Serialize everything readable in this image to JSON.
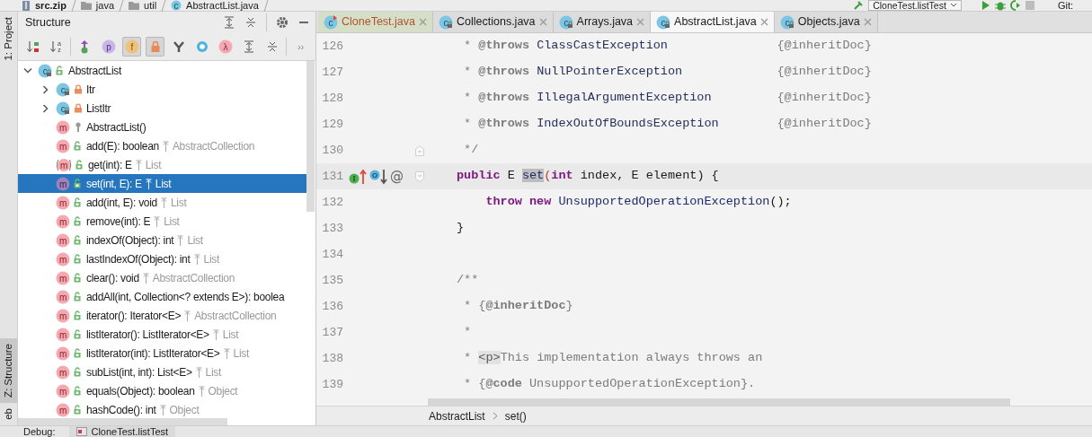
{
  "path_bar": {
    "segments": [
      {
        "label": "src.zip",
        "kind": "archive"
      },
      {
        "label": "java",
        "kind": "folder"
      },
      {
        "label": "util",
        "kind": "folder"
      },
      {
        "label": "AbstractList.java",
        "kind": "class-file",
        "badge": "c"
      }
    ],
    "run_config": "CloneTest.listTest",
    "vcs_label": "Git:"
  },
  "tool_stripe": {
    "top": [
      {
        "label": "1: Project",
        "selected": false
      }
    ],
    "bottom": [
      {
        "label": "Z: Structure",
        "selected": true
      },
      {
        "label": "eb",
        "selected": false
      }
    ]
  },
  "structure": {
    "title": "Structure",
    "toolbar": [
      {
        "kind": "sort-visibility",
        "pressed": false
      },
      {
        "kind": "sort-alpha",
        "glyph": "az",
        "pressed": false
      },
      {
        "kind": "separator"
      },
      {
        "kind": "inherited",
        "pressed": false
      },
      {
        "kind": "properties",
        "glyph": "p",
        "pressed": false
      },
      {
        "kind": "fields",
        "glyph": "f",
        "pressed": true
      },
      {
        "kind": "non-public",
        "pressed": true
      },
      {
        "kind": "anonymous",
        "pressed": false
      },
      {
        "kind": "circle",
        "pressed": false
      },
      {
        "kind": "lambda",
        "glyph": "λ",
        "pressed": false
      },
      {
        "kind": "expand",
        "pressed": false
      },
      {
        "kind": "collapse",
        "pressed": false
      },
      {
        "kind": "separator"
      },
      {
        "kind": "more",
        "glyph": "››",
        "pressed": false
      }
    ],
    "tree": [
      {
        "label": "AbstractList",
        "kind": "class",
        "badge": "c",
        "access": {
          "kind": "public"
        },
        "expanded": true,
        "selected": false,
        "children": [
          {
            "label": "Itr",
            "kind": "class",
            "badge": "c",
            "access": {
              "kind": "private"
            },
            "expanded": false,
            "selected": false
          },
          {
            "label": "ListItr",
            "kind": "class",
            "badge": "c",
            "access": {
              "kind": "private"
            },
            "expanded": false,
            "selected": false
          },
          {
            "label": "AbstractList()",
            "kind": "method",
            "badge": "m",
            "access": {
              "kind": "protected"
            },
            "selected": false
          },
          {
            "label": "add(E): boolean",
            "kind": "method",
            "badge": "m",
            "access": {
              "kind": "public"
            },
            "origin": "AbstractCollection",
            "selected": false
          },
          {
            "label": "get(int): E",
            "kind": "abstract-method",
            "badge": "m",
            "access": {
              "kind": "public"
            },
            "origin": "List",
            "selected": false
          },
          {
            "label": "set(int, E): E",
            "kind": "method",
            "badge": "m",
            "access": {
              "kind": "public"
            },
            "origin": "List",
            "selected": true
          },
          {
            "label": "add(int, E): void",
            "kind": "method",
            "badge": "m",
            "access": {
              "kind": "public"
            },
            "origin": "List",
            "selected": false
          },
          {
            "label": "remove(int): E",
            "kind": "method",
            "badge": "m",
            "access": {
              "kind": "public"
            },
            "origin": "List",
            "selected": false
          },
          {
            "label": "indexOf(Object): int",
            "kind": "method",
            "badge": "m",
            "access": {
              "kind": "public"
            },
            "origin": "List",
            "selected": false
          },
          {
            "label": "lastIndexOf(Object): int",
            "kind": "method",
            "badge": "m",
            "access": {
              "kind": "public"
            },
            "origin": "List",
            "selected": false
          },
          {
            "label": "clear(): void",
            "kind": "method",
            "badge": "m",
            "access": {
              "kind": "public"
            },
            "origin": "AbstractCollection",
            "selected": false
          },
          {
            "label": "addAll(int, Collection<? extends E>): boolea",
            "kind": "method",
            "badge": "m",
            "access": {
              "kind": "public"
            },
            "selected": false
          },
          {
            "label": "iterator(): Iterator<E>",
            "kind": "method",
            "badge": "m",
            "access": {
              "kind": "public"
            },
            "origin": "AbstractCollection",
            "selected": false
          },
          {
            "label": "listIterator(): ListIterator<E>",
            "kind": "method",
            "badge": "m",
            "access": {
              "kind": "public"
            },
            "origin": "List",
            "selected": false
          },
          {
            "label": "listIterator(int): ListIterator<E>",
            "kind": "method",
            "badge": "m",
            "access": {
              "kind": "public"
            },
            "origin": "List",
            "selected": false
          },
          {
            "label": "subList(int, int): List<E>",
            "kind": "method",
            "badge": "m",
            "access": {
              "kind": "public"
            },
            "origin": "List",
            "selected": false
          },
          {
            "label": "equals(Object): boolean",
            "kind": "method",
            "badge": "m",
            "access": {
              "kind": "public"
            },
            "origin": "Object",
            "selected": false
          },
          {
            "label": "hashCode(): int",
            "kind": "method",
            "badge": "m",
            "access": {
              "kind": "public"
            },
            "origin": "Object",
            "selected": false
          }
        ]
      }
    ]
  },
  "editor": {
    "tabs": [
      {
        "label": "CloneTest.java",
        "badge": "c",
        "kind": "runnable",
        "selected": false
      },
      {
        "label": "Collections.java",
        "badge": "c",
        "kind": "library",
        "selected": false
      },
      {
        "label": "Arrays.java",
        "badge": "c",
        "kind": "library",
        "selected": false
      },
      {
        "label": "AbstractList.java",
        "badge": "c",
        "kind": "library",
        "selected": true
      },
      {
        "label": "Objects.java",
        "badge": "c",
        "kind": "library",
        "selected": false
      }
    ],
    "lines": [
      {
        "number": "126",
        "segments": [
          {
            "kind": "comment",
            "text": " * "
          },
          {
            "kind": "doc-tag",
            "text": "@throws"
          },
          {
            "kind": "doc-ref",
            "text": " ClassCastException"
          },
          {
            "kind": "comment",
            "text": "               {@inheritDoc}"
          }
        ]
      },
      {
        "number": "127",
        "segments": [
          {
            "kind": "comment",
            "text": " * "
          },
          {
            "kind": "doc-tag",
            "text": "@throws"
          },
          {
            "kind": "doc-ref",
            "text": " NullPointerException"
          },
          {
            "kind": "comment",
            "text": "             {@inheritDoc}"
          }
        ]
      },
      {
        "number": "128",
        "segments": [
          {
            "kind": "comment",
            "text": " * "
          },
          {
            "kind": "doc-tag",
            "text": "@throws"
          },
          {
            "kind": "doc-ref",
            "text": " IllegalArgumentException"
          },
          {
            "kind": "comment",
            "text": "         {@inheritDoc}"
          }
        ]
      },
      {
        "number": "129",
        "segments": [
          {
            "kind": "comment",
            "text": " * "
          },
          {
            "kind": "doc-tag",
            "text": "@throws"
          },
          {
            "kind": "doc-ref",
            "text": " IndexOutOfBoundsException"
          },
          {
            "kind": "comment",
            "text": "        {@inheritDoc}"
          }
        ]
      },
      {
        "number": "130",
        "fold": {
          "kind": "end"
        },
        "segments": [
          {
            "kind": "comment",
            "text": " */"
          }
        ]
      },
      {
        "number": "131",
        "current": true,
        "fold": {
          "kind": "start"
        },
        "markers": [
          {
            "kind": "implements",
            "glyph": "I"
          },
          {
            "kind": "overrides",
            "glyph": "O"
          },
          {
            "kind": "annotation",
            "glyph": "@"
          }
        ],
        "segments": [
          {
            "kind": "keyword",
            "text": "public"
          },
          {
            "kind": "plain",
            "text": " E "
          },
          {
            "kind": "selected",
            "text": "set"
          },
          {
            "kind": "paren",
            "text": "("
          },
          {
            "kind": "keyword",
            "text": "int"
          },
          {
            "kind": "plain",
            "text": " index, E element) {"
          }
        ]
      },
      {
        "number": "132",
        "segments": [
          {
            "kind": "keyword",
            "text": "    throw"
          },
          {
            "kind": "keyword",
            "text": " new"
          },
          {
            "kind": "type",
            "text": " UnsupportedOperationException"
          },
          {
            "kind": "plain",
            "text": "();"
          }
        ]
      },
      {
        "number": "133",
        "segments": [
          {
            "kind": "plain",
            "text": "}"
          }
        ]
      },
      {
        "number": "134"
      },
      {
        "number": "135",
        "segments": [
          {
            "kind": "comment",
            "text": "/**"
          }
        ]
      },
      {
        "number": "136",
        "segments": [
          {
            "kind": "comment",
            "text": " * {"
          },
          {
            "kind": "doc-tag",
            "text": "@inheritDoc"
          },
          {
            "kind": "comment",
            "text": "}"
          }
        ]
      },
      {
        "number": "137",
        "segments": [
          {
            "kind": "comment",
            "text": " *"
          }
        ]
      },
      {
        "number": "138",
        "segments": [
          {
            "kind": "comment",
            "text": " * "
          },
          {
            "kind": "doc-markup",
            "text": "<p>"
          },
          {
            "kind": "comment",
            "text": "This implementation always throws an"
          }
        ]
      },
      {
        "number": "139",
        "segments": [
          {
            "kind": "comment",
            "text": " * {"
          },
          {
            "kind": "doc-tag",
            "text": "@code"
          },
          {
            "kind": "comment",
            "text": " UnsupportedOperationException}."
          }
        ]
      }
    ],
    "breadcrumb": [
      "AbstractList",
      "set()"
    ]
  },
  "bottom_bar": {
    "label": "Debug:",
    "tab": "CloneTest.listTest"
  }
}
